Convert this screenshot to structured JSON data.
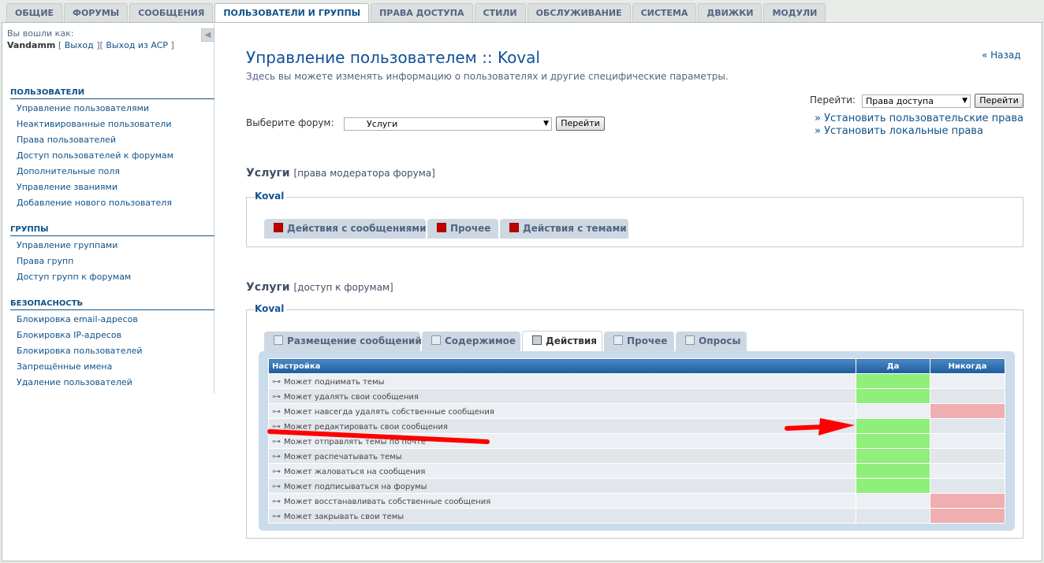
{
  "top_tabs": [
    {
      "label": "ОБЩИЕ"
    },
    {
      "label": "ФОРУМЫ"
    },
    {
      "label": "СООБЩЕНИЯ"
    },
    {
      "label": "ПОЛЬЗОВАТЕЛИ И ГРУППЫ"
    },
    {
      "label": "ПРАВА ДОСТУПА"
    },
    {
      "label": "СТИЛИ"
    },
    {
      "label": "ОБСЛУЖИВАНИЕ"
    },
    {
      "label": "СИСТЕМА"
    },
    {
      "label": "ДВИЖКИ"
    },
    {
      "label": "МОДУЛИ"
    }
  ],
  "login": {
    "logged_as": "Вы вошли как:",
    "username": "Vandamm",
    "logout": "Выход",
    "logout_acp": "Выход из ACP"
  },
  "sidebar": {
    "users_title": "ПОЛЬЗОВАТЕЛИ",
    "users_items": [
      "Управление пользователями",
      "Неактивированные пользователи",
      "Права пользователей",
      "Доступ пользователей к форумам",
      "Дополнительные поля",
      "Управление званиями",
      "Добавление нового пользователя"
    ],
    "groups_title": "ГРУППЫ",
    "groups_items": [
      "Управление группами",
      "Права групп",
      "Доступ групп к форумам"
    ],
    "security_title": "БЕЗОПАСНОСТЬ",
    "security_items": [
      "Блокировка email-адресов",
      "Блокировка IP-адресов",
      "Блокировка пользователей",
      "Запрещённые имена",
      "Удаление пользователей"
    ]
  },
  "header": {
    "title": "Управление пользователем :: Koval",
    "subtitle": "Здесь вы можете изменять информацию о пользователях и другие специфические параметры.",
    "back": "« Назад"
  },
  "goto": {
    "label": "Перейти:",
    "selected": "Права доступа",
    "button": "Перейти",
    "link_user_perms": "» Установить пользовательские права",
    "link_local_perms": "» Установить локальные права"
  },
  "forum_select": {
    "label": "Выберите форум:",
    "selected": "Услуги",
    "button": "Перейти"
  },
  "moderator_section": {
    "title": "Услуги",
    "suffix": "[права модератора форума]",
    "user": "Koval",
    "tabs": [
      "Действия с сообщениями",
      "Прочее",
      "Действия с темами"
    ]
  },
  "forum_section": {
    "title": "Услуги",
    "suffix": "[доступ к форумам]",
    "user": "Koval",
    "tabs": [
      "Размещение сообщений",
      "Содержимое",
      "Действия",
      "Прочее",
      "Опросы"
    ],
    "active_tab": "Действия",
    "table": {
      "headers": [
        "Настройка",
        "Да",
        "Никогда"
      ],
      "rows": [
        {
          "name": "Может поднимать темы",
          "value": "yes"
        },
        {
          "name": "Может удалять свои сообщения",
          "value": "yes"
        },
        {
          "name": "Может навсегда удалять собственные сообщения",
          "value": "never"
        },
        {
          "name": "Может редактировать свои сообщения",
          "value": "yes"
        },
        {
          "name": "Может отправлять темы по почте",
          "value": "yes"
        },
        {
          "name": "Может распечатывать темы",
          "value": "yes"
        },
        {
          "name": "Может жаловаться на сообщения",
          "value": "yes"
        },
        {
          "name": "Может подписываться на форумы",
          "value": "yes"
        },
        {
          "name": "Может восстанавливать собственные сообщения",
          "value": "never"
        },
        {
          "name": "Может закрывать свои темы",
          "value": "never"
        }
      ]
    }
  },
  "colors": {
    "yes": "#90ee7a",
    "never": "#f0aeb0",
    "annotation": "#ff0000"
  }
}
